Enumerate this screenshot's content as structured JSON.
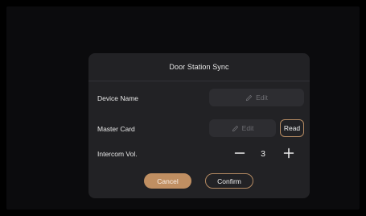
{
  "dialog": {
    "title": "Door Station Sync",
    "device_name": {
      "label": "Device Name",
      "edit_label": "Edit"
    },
    "master_card": {
      "label": "Master Card",
      "edit_label": "Edit",
      "read_label": "Read"
    },
    "intercom_vol": {
      "label": "Intercom Vol.",
      "value": "3"
    },
    "buttons": {
      "cancel_label": "Cancel",
      "confirm_label": "Confirm"
    }
  },
  "colors": {
    "accent": "#c08f62",
    "accent_outline": "#b48a62",
    "dialog_background": "#222225",
    "field_background": "#2d2d31",
    "muted_text": "#6d6d72"
  },
  "icons": {
    "edit": "pencil-icon",
    "decrease": "minus-icon",
    "increase": "plus-icon"
  }
}
